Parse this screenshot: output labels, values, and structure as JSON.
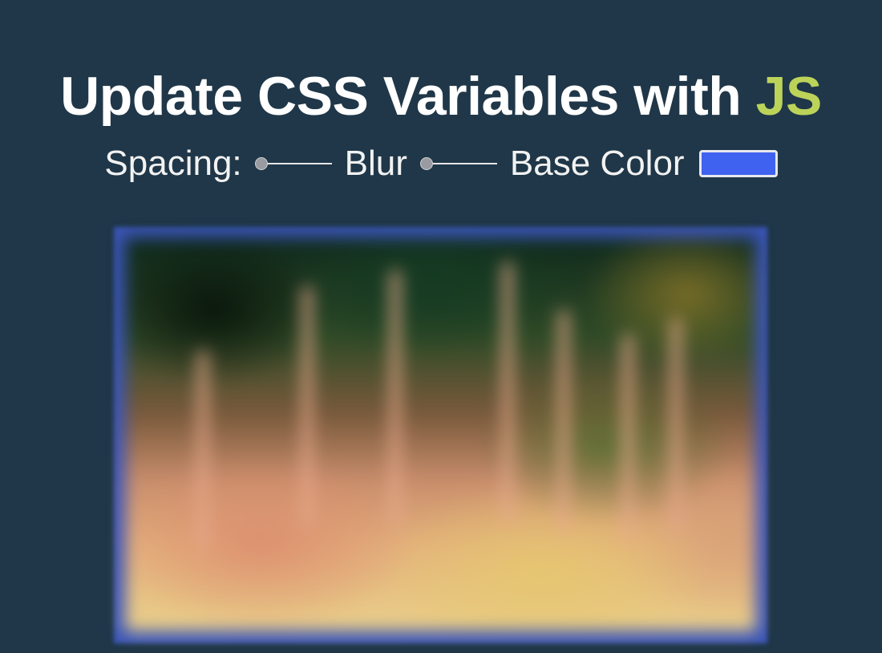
{
  "title": {
    "main": "Update CSS Variables with",
    "highlight": "JS"
  },
  "controls": {
    "spacing_label": "Spacing:",
    "blur_label": "Blur",
    "base_color_label": "Base Color",
    "spacing_value": 0,
    "blur_value": 0,
    "base_color_value": "#4062f0"
  },
  "colors": {
    "background": "#1f3748",
    "highlight": "#bcd35a",
    "base": "#4062f0"
  },
  "image": {
    "subject": "blurred photo of grass stalks"
  }
}
